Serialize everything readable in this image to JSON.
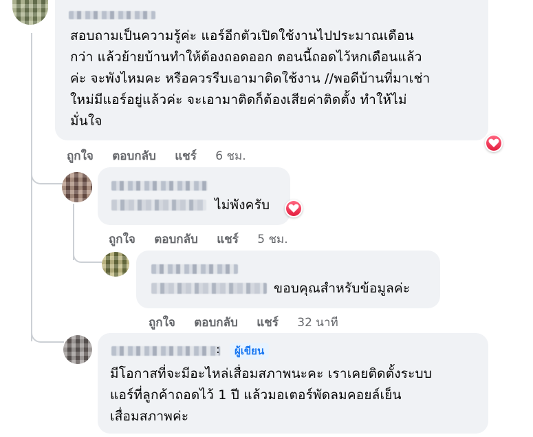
{
  "comments": [
    {
      "text_lines": [
        "สอบถามเป็นความรู้ค่ะ แอร์อีกตัวเปิดใช้งานไปประมาณเดือน",
        "กว่า แล้วย้ายบ้านทำให้ต้องถอดออก ตอนนี้ถอดไว้หกเดือนแล้ว",
        "ค่ะ จะพังไหมคะ หรือควรรีบเอามาติดใช้งาน //พอดีบ้านที่มาเช่า",
        "ใหม่มีแอร์อยู่แล้วค่ะ จะเอามาติดก็ต้องเสียค่าติดตั้ง ทำให้ไม่",
        "มั่นใจ"
      ],
      "like": "ถูกใจ",
      "reply": "ตอบกลับ",
      "share": "แชร์",
      "time": "6 ชม."
    },
    {
      "text": "ไม่พังครับ",
      "like": "ถูกใจ",
      "reply": "ตอบกลับ",
      "share": "แชร์",
      "time": "5 ชม."
    },
    {
      "text": "ขอบคุณสำหรับข้อมูลค่ะ",
      "like": "ถูกใจ",
      "reply": "ตอบกลับ",
      "share": "แชร์",
      "time": "32 นาที"
    },
    {
      "badge": "ผู้เขียน",
      "colon": ":",
      "text_lines": [
        "มีโอกาสที่จะมีอะไหล่เสื่อมสภาพนะคะ เราเคยติดตั้งระบบ",
        "แอร์ที่ลูกค้าถอดไว้ 1 ปี แล้วมอเตอร์พัดลมคอยล์เย็น",
        "เสื่อมสภาพค่ะ"
      ]
    }
  ],
  "icons": {
    "reaction": "heart-reaction-icon"
  },
  "colors": {
    "bubble": "#f0f2f5",
    "meta": "#65676b",
    "badge_text": "#1877f2",
    "badge_bg": "#e7f3ff",
    "heart": "#e41e3f"
  }
}
